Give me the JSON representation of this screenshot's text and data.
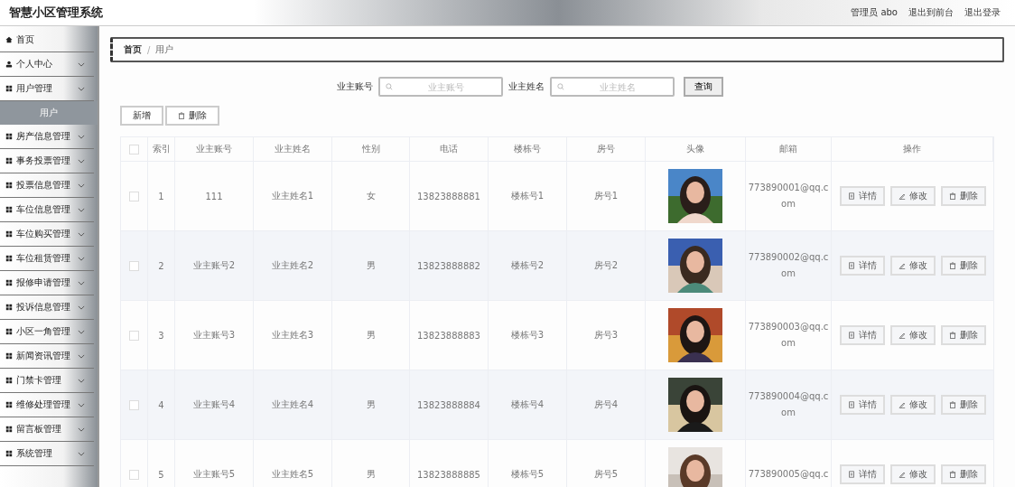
{
  "header": {
    "title": "智慧小区管理系统",
    "user": "管理员 abo",
    "links": [
      "退出到前台",
      "退出登录"
    ]
  },
  "sidebar": {
    "items": [
      {
        "label": "首页",
        "expandable": false
      },
      {
        "label": "个人中心",
        "expandable": true
      },
      {
        "label": "用户管理",
        "expandable": true,
        "children": [
          {
            "label": "用户",
            "selected": true
          }
        ]
      },
      {
        "label": "房产信息管理",
        "expandable": true
      },
      {
        "label": "事务投票管理",
        "expandable": true
      },
      {
        "label": "投票信息管理",
        "expandable": true
      },
      {
        "label": "车位信息管理",
        "expandable": true
      },
      {
        "label": "车位购买管理",
        "expandable": true
      },
      {
        "label": "车位租赁管理",
        "expandable": true
      },
      {
        "label": "报修申请管理",
        "expandable": true
      },
      {
        "label": "投诉信息管理",
        "expandable": true
      },
      {
        "label": "小区一角管理",
        "expandable": true
      },
      {
        "label": "新闻资讯管理",
        "expandable": true
      },
      {
        "label": "门禁卡管理",
        "expandable": true
      },
      {
        "label": "维修处理管理",
        "expandable": true
      },
      {
        "label": "留言板管理",
        "expandable": true
      },
      {
        "label": "系统管理",
        "expandable": true
      }
    ]
  },
  "breadcrumb": {
    "items": [
      "首页",
      "用户"
    ],
    "separator": "/"
  },
  "search": {
    "fields": [
      {
        "label": "业主账号",
        "placeholder": "业主账号"
      },
      {
        "label": "业主姓名",
        "placeholder": "业主姓名"
      }
    ],
    "button": "查询"
  },
  "actions": [
    "新增",
    "删除"
  ],
  "table": {
    "all_checked": false,
    "columns": [
      "索引",
      "业主账号",
      "业主姓名",
      "性别",
      "电话",
      "楼栋号",
      "房号",
      "头像",
      "邮箱",
      "操作"
    ],
    "rows": [
      {
        "checked": false,
        "cells": [
          "1",
          "111",
          "业主姓名1",
          "女",
          "13823888881",
          "楼栋号1",
          "房号1"
        ],
        "email": "773890001@qq.com",
        "buttons": [
          "详情",
          "修改",
          "删除"
        ]
      },
      {
        "checked": false,
        "cells": [
          "2",
          "业主账号2",
          "业主姓名2",
          "男",
          "13823888882",
          "楼栋号2",
          "房号2"
        ],
        "email": "773890002@qq.com",
        "buttons": [
          "详情",
          "修改",
          "删除"
        ]
      },
      {
        "checked": false,
        "cells": [
          "3",
          "业主账号3",
          "业主姓名3",
          "男",
          "13823888883",
          "楼栋号3",
          "房号3"
        ],
        "email": "773890003@qq.com",
        "buttons": [
          "详情",
          "修改",
          "删除"
        ]
      },
      {
        "checked": false,
        "cells": [
          "4",
          "业主账号4",
          "业主姓名4",
          "男",
          "13823888884",
          "楼栋号4",
          "房号4"
        ],
        "email": "773890004@qq.com",
        "buttons": [
          "详情",
          "修改",
          "删除"
        ]
      },
      {
        "checked": false,
        "cells": [
          "5",
          "业主账号5",
          "业主姓名5",
          "男",
          "13823888885",
          "楼栋号5",
          "房号5"
        ],
        "email": "773890005@qq.c",
        "buttons": [
          "详情",
          "修改",
          "删除"
        ]
      }
    ]
  }
}
